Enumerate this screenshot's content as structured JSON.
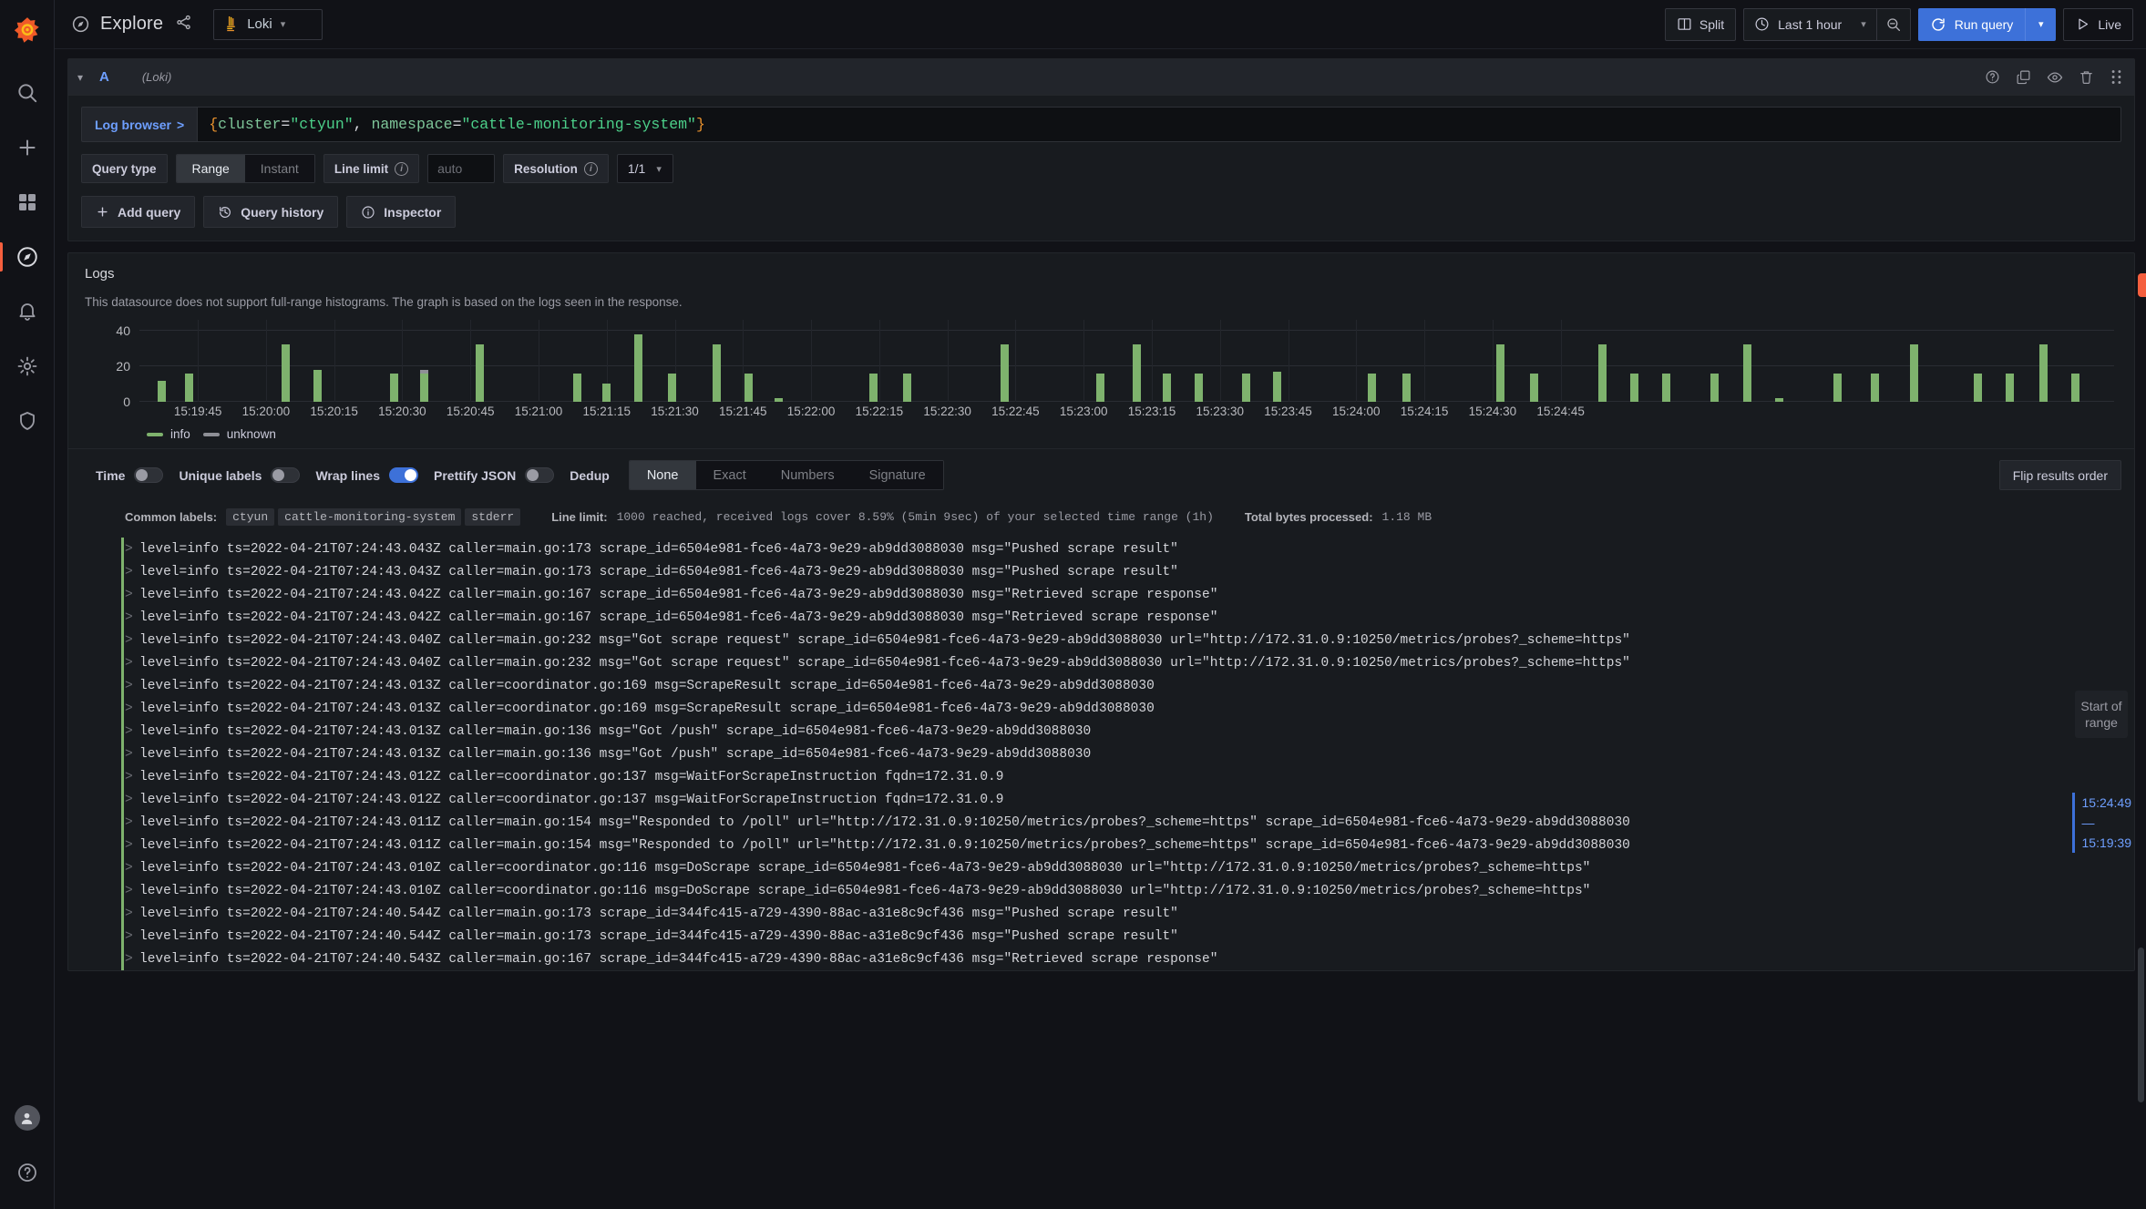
{
  "sidebar": {
    "logo": "grafana-logo",
    "items": [
      {
        "icon": "search-icon",
        "name": "search",
        "active": false
      },
      {
        "icon": "plus-icon",
        "name": "create",
        "active": false
      },
      {
        "icon": "dashboards-icon",
        "name": "dashboards",
        "active": false
      },
      {
        "icon": "compass-icon",
        "name": "explore",
        "active": true
      },
      {
        "icon": "bell-icon",
        "name": "alerting",
        "active": false
      },
      {
        "icon": "gear-icon",
        "name": "configuration",
        "active": false
      },
      {
        "icon": "shield-icon",
        "name": "server-admin",
        "active": false
      }
    ],
    "bottom": [
      {
        "icon": "avatar",
        "name": "user-profile"
      },
      {
        "icon": "question-icon",
        "name": "help"
      }
    ]
  },
  "topnav": {
    "title": "Explore",
    "compass_icon": "compass-icon",
    "share_icon": "share-icon",
    "datasource": "Loki",
    "datasource_icon": "loki-icon",
    "split_label": "Split",
    "split_icon": "split-panes-icon",
    "time_range": "Last 1 hour",
    "clock_icon": "clock-icon",
    "zoom_out_icon": "zoom-out-icon",
    "run_query_label": "Run query",
    "refresh_icon": "refresh-icon",
    "live_label": "Live",
    "live_icon": "play-icon"
  },
  "query": {
    "ref_id": "A",
    "datasource_label": "(Loki)",
    "collapse_icon": "chevron-down-icon",
    "header_actions": [
      {
        "name": "help-icon"
      },
      {
        "name": "duplicate-query-icon"
      },
      {
        "name": "hide-response-icon"
      },
      {
        "name": "remove-query-icon"
      },
      {
        "name": "drag-handle-icon"
      }
    ],
    "log_browser_label": "Log browser",
    "log_browser_chevron": ">",
    "expr_tokens": [
      {
        "t": "{",
        "c": "brace"
      },
      {
        "t": "cluster",
        "c": "label"
      },
      {
        "t": "=",
        "c": "op"
      },
      {
        "t": "\"ctyun\"",
        "c": "str"
      },
      {
        "t": ", ",
        "c": "op"
      },
      {
        "t": "namespace",
        "c": "label"
      },
      {
        "t": "=",
        "c": "op"
      },
      {
        "t": "\"cattle-monitoring-system\"",
        "c": "str"
      },
      {
        "t": "}",
        "c": "brace"
      }
    ],
    "query_type_label": "Query type",
    "query_type_options": [
      "Range",
      "Instant"
    ],
    "query_type_selected": "Range",
    "line_limit_label": "Line limit",
    "line_limit_placeholder": "auto",
    "line_limit_value": "",
    "resolution_label": "Resolution",
    "resolution_value": "1/1",
    "add_query_label": "Add query",
    "query_history_label": "Query history",
    "inspector_label": "Inspector"
  },
  "logs_panel": {
    "title": "Logs",
    "note": "This datasource does not support full-range histograms. The graph is based on the logs seen in the response.",
    "legend": [
      {
        "label": "info",
        "color": "#7eb26d"
      },
      {
        "label": "unknown",
        "color": "#8e8f96"
      }
    ],
    "controls": {
      "time_label": "Time",
      "time_on": false,
      "unique_labels_label": "Unique labels",
      "unique_labels_on": false,
      "wrap_lines_label": "Wrap lines",
      "wrap_lines_on": true,
      "prettify_json_label": "Prettify JSON",
      "prettify_json_on": false,
      "dedup_label": "Dedup",
      "dedup_options": [
        "None",
        "Exact",
        "Numbers",
        "Signature"
      ],
      "dedup_selected": "None",
      "flip_results_label": "Flip results order"
    },
    "meta": {
      "common_labels_key": "Common labels:",
      "common_labels": [
        "ctyun",
        "cattle-monitoring-system",
        "stderr"
      ],
      "line_limit_key": "Line limit:",
      "line_limit_text": "1000 reached, received logs cover 8.59% (5min 9sec) of your selected time range (1h)",
      "bytes_key": "Total bytes processed:",
      "bytes_value": "1.18 MB"
    },
    "range_badge": "Start of range",
    "range_start": "15:24:49",
    "range_dash": "—",
    "range_end": "15:19:39"
  },
  "chart_data": {
    "type": "bar",
    "title": "",
    "xlabel": "",
    "ylabel": "",
    "ylim": [
      0,
      46
    ],
    "yticks": [
      0,
      20,
      40
    ],
    "grid": true,
    "legend_position": "bottom-left",
    "xticks": [
      "15:19:45",
      "15:20:00",
      "15:20:15",
      "15:20:30",
      "15:20:45",
      "15:21:00",
      "15:21:15",
      "15:21:30",
      "15:21:45",
      "15:22:00",
      "15:22:15",
      "15:22:30",
      "15:22:45",
      "15:23:00",
      "15:23:15",
      "15:23:30",
      "15:23:45",
      "15:24:00",
      "15:24:15",
      "15:24:30",
      "15:24:45"
    ],
    "xtick_positions": [
      4.2,
      9.1,
      14.0,
      18.9,
      23.8,
      28.7,
      33.6,
      38.5,
      43.4,
      48.3,
      53.2,
      58.1,
      63.0,
      67.9,
      72.8,
      77.7,
      82.6,
      87.5,
      92.4,
      97.3,
      102.2
    ],
    "series": [
      {
        "name": "info",
        "color": "#7eb26d"
      },
      {
        "name": "unknown",
        "color": "#8e8f96"
      }
    ],
    "bars": [
      {
        "x": 1.3,
        "info": 12,
        "unknown": 0
      },
      {
        "x": 3.3,
        "info": 16,
        "unknown": 0
      },
      {
        "x": 10.2,
        "info": 32,
        "unknown": 0
      },
      {
        "x": 12.5,
        "info": 18,
        "unknown": 0
      },
      {
        "x": 18.0,
        "info": 16,
        "unknown": 0
      },
      {
        "x": 20.2,
        "info": 16,
        "unknown": 2
      },
      {
        "x": 24.2,
        "info": 32,
        "unknown": 0
      },
      {
        "x": 31.2,
        "info": 16,
        "unknown": 0
      },
      {
        "x": 33.3,
        "info": 10,
        "unknown": 0
      },
      {
        "x": 35.6,
        "info": 38,
        "unknown": 0
      },
      {
        "x": 38.0,
        "info": 16,
        "unknown": 0
      },
      {
        "x": 41.2,
        "info": 32,
        "unknown": 0
      },
      {
        "x": 43.5,
        "info": 16,
        "unknown": 0
      },
      {
        "x": 45.7,
        "info": 2,
        "unknown": 0
      },
      {
        "x": 52.5,
        "info": 16,
        "unknown": 0
      },
      {
        "x": 54.9,
        "info": 16,
        "unknown": 0
      },
      {
        "x": 61.9,
        "info": 32,
        "unknown": 0
      },
      {
        "x": 68.8,
        "info": 16,
        "unknown": 0
      },
      {
        "x": 71.4,
        "info": 32,
        "unknown": 0
      },
      {
        "x": 73.6,
        "info": 16,
        "unknown": 0
      },
      {
        "x": 75.9,
        "info": 16,
        "unknown": 0
      },
      {
        "x": 79.3,
        "info": 16,
        "unknown": 0
      },
      {
        "x": 81.5,
        "info": 17,
        "unknown": 0
      },
      {
        "x": 88.3,
        "info": 16,
        "unknown": 0
      },
      {
        "x": 90.8,
        "info": 16,
        "unknown": 0
      },
      {
        "x": 97.6,
        "info": 32,
        "unknown": 0
      },
      {
        "x": 100.0,
        "info": 16,
        "unknown": 0
      },
      {
        "x": 104.9,
        "info": 32,
        "unknown": 0
      },
      {
        "x": 107.2,
        "info": 16,
        "unknown": 0
      },
      {
        "x": 109.5,
        "info": 16,
        "unknown": 0
      },
      {
        "x": 113.0,
        "info": 16,
        "unknown": 0
      },
      {
        "x": 115.3,
        "info": 32,
        "unknown": 0
      },
      {
        "x": 117.6,
        "info": 2,
        "unknown": 0
      },
      {
        "x": 121.8,
        "info": 16,
        "unknown": 0
      },
      {
        "x": 124.5,
        "info": 16,
        "unknown": 0
      },
      {
        "x": 127.3,
        "info": 32,
        "unknown": 0
      },
      {
        "x": 131.9,
        "info": 16,
        "unknown": 0
      },
      {
        "x": 134.2,
        "info": 16,
        "unknown": 0
      },
      {
        "x": 136.6,
        "info": 32,
        "unknown": 0
      },
      {
        "x": 138.9,
        "info": 16,
        "unknown": 0
      }
    ]
  },
  "log_lines": [
    {
      "level": "info",
      "text": "level=info ts=2022-04-21T07:24:43.043Z caller=main.go:173 scrape_id=6504e981-fce6-4a73-9e29-ab9dd3088030 msg=\"Pushed scrape result\""
    },
    {
      "level": "info",
      "text": "level=info ts=2022-04-21T07:24:43.043Z caller=main.go:173 scrape_id=6504e981-fce6-4a73-9e29-ab9dd3088030 msg=\"Pushed scrape result\""
    },
    {
      "level": "info",
      "text": "level=info ts=2022-04-21T07:24:43.042Z caller=main.go:167 scrape_id=6504e981-fce6-4a73-9e29-ab9dd3088030 msg=\"Retrieved scrape response\""
    },
    {
      "level": "info",
      "text": "level=info ts=2022-04-21T07:24:43.042Z caller=main.go:167 scrape_id=6504e981-fce6-4a73-9e29-ab9dd3088030 msg=\"Retrieved scrape response\""
    },
    {
      "level": "info",
      "text": "level=info ts=2022-04-21T07:24:43.040Z caller=main.go:232 msg=\"Got scrape request\" scrape_id=6504e981-fce6-4a73-9e29-ab9dd3088030 url=\"http://172.31.0.9:10250/metrics/probes?_scheme=https\""
    },
    {
      "level": "info",
      "text": "level=info ts=2022-04-21T07:24:43.040Z caller=main.go:232 msg=\"Got scrape request\" scrape_id=6504e981-fce6-4a73-9e29-ab9dd3088030 url=\"http://172.31.0.9:10250/metrics/probes?_scheme=https\""
    },
    {
      "level": "info",
      "text": "level=info ts=2022-04-21T07:24:43.013Z caller=coordinator.go:169 msg=ScrapeResult scrape_id=6504e981-fce6-4a73-9e29-ab9dd3088030"
    },
    {
      "level": "info",
      "text": "level=info ts=2022-04-21T07:24:43.013Z caller=coordinator.go:169 msg=ScrapeResult scrape_id=6504e981-fce6-4a73-9e29-ab9dd3088030"
    },
    {
      "level": "info",
      "text": "level=info ts=2022-04-21T07:24:43.013Z caller=main.go:136 msg=\"Got /push\" scrape_id=6504e981-fce6-4a73-9e29-ab9dd3088030"
    },
    {
      "level": "info",
      "text": "level=info ts=2022-04-21T07:24:43.013Z caller=main.go:136 msg=\"Got /push\" scrape_id=6504e981-fce6-4a73-9e29-ab9dd3088030"
    },
    {
      "level": "info",
      "text": "level=info ts=2022-04-21T07:24:43.012Z caller=coordinator.go:137 msg=WaitForScrapeInstruction fqdn=172.31.0.9"
    },
    {
      "level": "info",
      "text": "level=info ts=2022-04-21T07:24:43.012Z caller=coordinator.go:137 msg=WaitForScrapeInstruction fqdn=172.31.0.9"
    },
    {
      "level": "info",
      "text": "level=info ts=2022-04-21T07:24:43.011Z caller=main.go:154 msg=\"Responded to /poll\" url=\"http://172.31.0.9:10250/metrics/probes?_scheme=https\" scrape_id=6504e981-fce6-4a73-9e29-ab9dd3088030"
    },
    {
      "level": "info",
      "text": "level=info ts=2022-04-21T07:24:43.011Z caller=main.go:154 msg=\"Responded to /poll\" url=\"http://172.31.0.9:10250/metrics/probes?_scheme=https\" scrape_id=6504e981-fce6-4a73-9e29-ab9dd3088030"
    },
    {
      "level": "info",
      "text": "level=info ts=2022-04-21T07:24:43.010Z caller=coordinator.go:116 msg=DoScrape scrape_id=6504e981-fce6-4a73-9e29-ab9dd3088030 url=\"http://172.31.0.9:10250/metrics/probes?_scheme=https\""
    },
    {
      "level": "info",
      "text": "level=info ts=2022-04-21T07:24:43.010Z caller=coordinator.go:116 msg=DoScrape scrape_id=6504e981-fce6-4a73-9e29-ab9dd3088030 url=\"http://172.31.0.9:10250/metrics/probes?_scheme=https\""
    },
    {
      "level": "info",
      "text": "level=info ts=2022-04-21T07:24:40.544Z caller=main.go:173 scrape_id=344fc415-a729-4390-88ac-a31e8c9cf436 msg=\"Pushed scrape result\""
    },
    {
      "level": "info",
      "text": "level=info ts=2022-04-21T07:24:40.544Z caller=main.go:173 scrape_id=344fc415-a729-4390-88ac-a31e8c9cf436 msg=\"Pushed scrape result\""
    },
    {
      "level": "info",
      "text": "level=info ts=2022-04-21T07:24:40.543Z caller=main.go:167 scrape_id=344fc415-a729-4390-88ac-a31e8c9cf436 msg=\"Retrieved scrape response\""
    }
  ]
}
